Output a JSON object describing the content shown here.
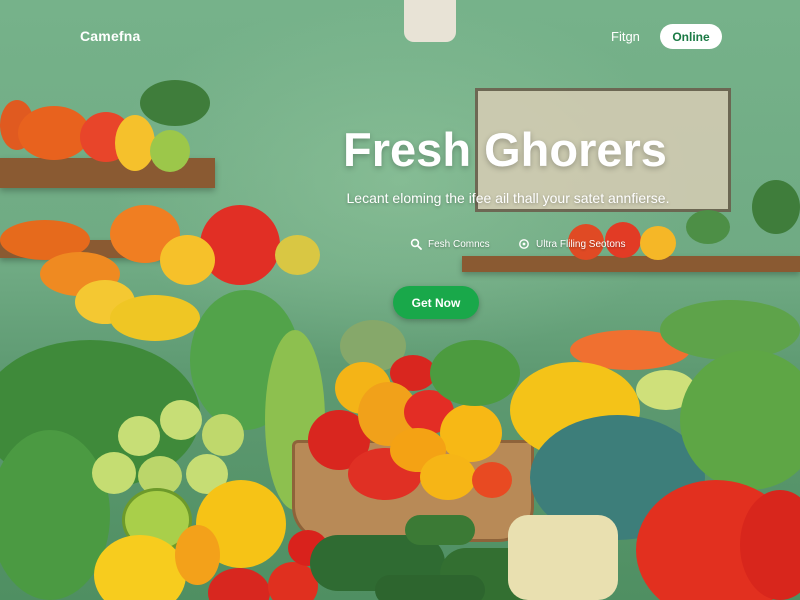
{
  "nav": {
    "logo": "Camefna",
    "login": "Fitgn",
    "online_button": "Online"
  },
  "hero": {
    "title": "Fresh Ghorers",
    "subtitle": "Lecant eloming the ifee ail thall your satet annfierse.",
    "features": [
      {
        "icon": "search-icon",
        "label": "Fesh Comncs"
      },
      {
        "icon": "refresh-icon",
        "label": "Ultra Fliling Seotons"
      }
    ],
    "cta": "Get Now"
  },
  "colors": {
    "brand_green": "#19a84a",
    "wall_green": "#76b28a",
    "text": "#ffffff"
  }
}
